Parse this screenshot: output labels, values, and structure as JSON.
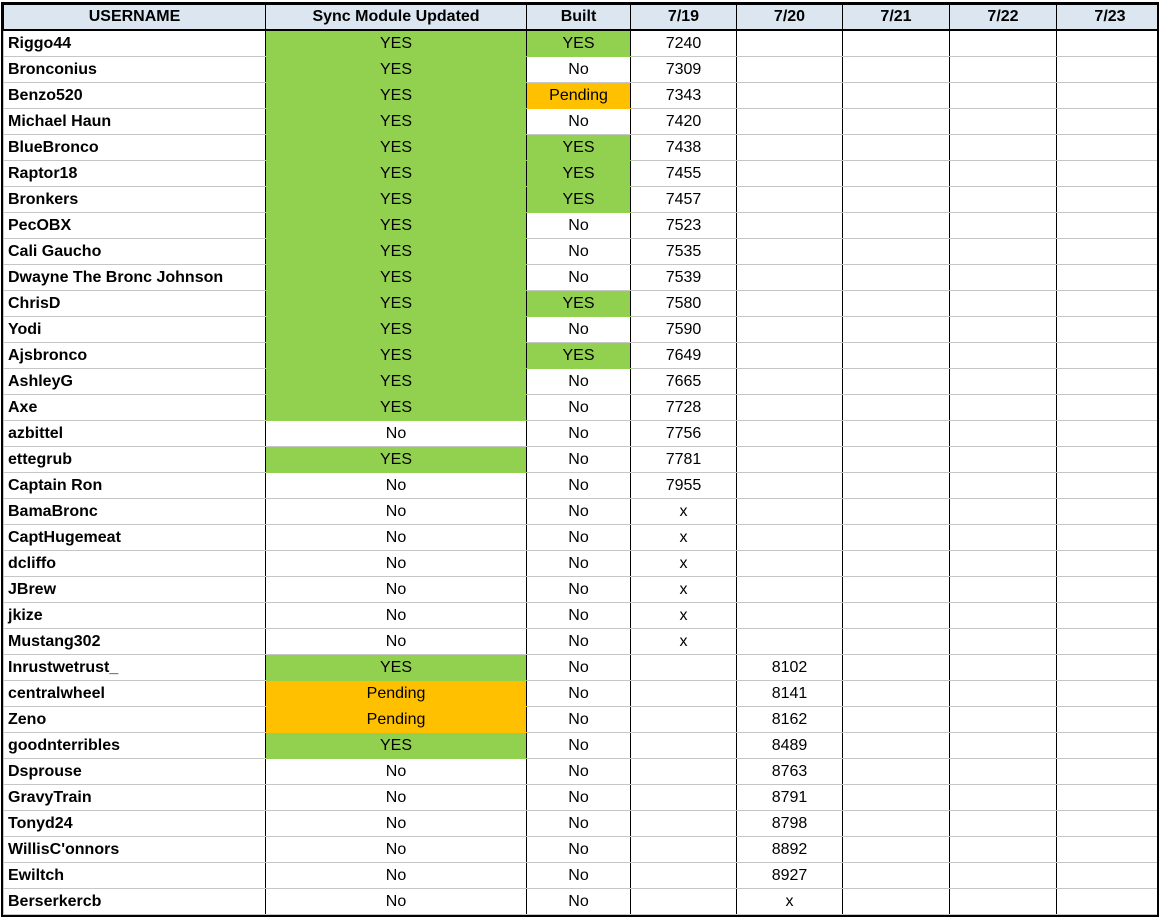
{
  "headers": [
    "USERNAME",
    "Sync Module Updated",
    "Built",
    "7/19",
    "7/20",
    "7/21",
    "7/22",
    "7/23"
  ],
  "colors": {
    "yes": "#92d050",
    "pending": "#ffc000",
    "header": "#dce6f1"
  },
  "rows": [
    [
      "Riggo44",
      "YES",
      "YES",
      "7240",
      "",
      "",
      "",
      ""
    ],
    [
      "Bronconius",
      "YES",
      "No",
      "7309",
      "",
      "",
      "",
      ""
    ],
    [
      "Benzo520",
      "YES",
      "Pending",
      "7343",
      "",
      "",
      "",
      ""
    ],
    [
      "Michael Haun",
      "YES",
      "No",
      "7420",
      "",
      "",
      "",
      ""
    ],
    [
      "BlueBronco",
      "YES",
      "YES",
      "7438",
      "",
      "",
      "",
      ""
    ],
    [
      "Raptor18",
      "YES",
      "YES",
      "7455",
      "",
      "",
      "",
      ""
    ],
    [
      "Bronkers",
      "YES",
      "YES",
      "7457",
      "",
      "",
      "",
      ""
    ],
    [
      "PecOBX",
      "YES",
      "No",
      "7523",
      "",
      "",
      "",
      ""
    ],
    [
      "Cali Gaucho",
      "YES",
      "No",
      "7535",
      "",
      "",
      "",
      ""
    ],
    [
      "Dwayne The Bronc Johnson",
      "YES",
      "No",
      "7539",
      "",
      "",
      "",
      ""
    ],
    [
      "ChrisD",
      "YES",
      "YES",
      "7580",
      "",
      "",
      "",
      ""
    ],
    [
      "Yodi",
      "YES",
      "No",
      "7590",
      "",
      "",
      "",
      ""
    ],
    [
      "Ajsbronco",
      "YES",
      "YES",
      "7649",
      "",
      "",
      "",
      ""
    ],
    [
      "AshleyG",
      "YES",
      "No",
      "7665",
      "",
      "",
      "",
      ""
    ],
    [
      "Axe",
      "YES",
      "No",
      "7728",
      "",
      "",
      "",
      ""
    ],
    [
      "azbittel",
      "No",
      "No",
      "7756",
      "",
      "",
      "",
      ""
    ],
    [
      "ettegrub",
      "YES",
      "No",
      "7781",
      "",
      "",
      "",
      ""
    ],
    [
      "Captain Ron",
      "No",
      "No",
      "7955",
      "",
      "",
      "",
      ""
    ],
    [
      "BamaBronc",
      "No",
      "No",
      "x",
      "",
      "",
      "",
      ""
    ],
    [
      "CaptHugemeat",
      "No",
      "No",
      "x",
      "",
      "",
      "",
      ""
    ],
    [
      "dcliffo",
      "No",
      "No",
      "x",
      "",
      "",
      "",
      ""
    ],
    [
      "JBrew",
      "No",
      "No",
      "x",
      "",
      "",
      "",
      ""
    ],
    [
      "jkize",
      "No",
      "No",
      "x",
      "",
      "",
      "",
      ""
    ],
    [
      "Mustang302",
      "No",
      "No",
      "x",
      "",
      "",
      "",
      ""
    ],
    [
      "Inrustwetrust_",
      "YES",
      "No",
      "",
      "8102",
      "",
      "",
      ""
    ],
    [
      "centralwheel",
      "Pending",
      "No",
      "",
      "8141",
      "",
      "",
      ""
    ],
    [
      "Zeno",
      "Pending",
      "No",
      "",
      "8162",
      "",
      "",
      ""
    ],
    [
      "goodnterribles",
      "YES",
      "No",
      "",
      "8489",
      "",
      "",
      ""
    ],
    [
      "Dsprouse",
      "No",
      "No",
      "",
      "8763",
      "",
      "",
      ""
    ],
    [
      "GravyTrain",
      "No",
      "No",
      "",
      "8791",
      "",
      "",
      ""
    ],
    [
      "Tonyd24",
      "No",
      "No",
      "",
      "8798",
      "",
      "",
      ""
    ],
    [
      "WillisC'onnors",
      "No",
      "No",
      "",
      "8892",
      "",
      "",
      ""
    ],
    [
      "Ewiltch",
      "No",
      "No",
      "",
      "8927",
      "",
      "",
      ""
    ],
    [
      "Berserkercb",
      "No",
      "No",
      "",
      "x",
      "",
      "",
      ""
    ]
  ]
}
